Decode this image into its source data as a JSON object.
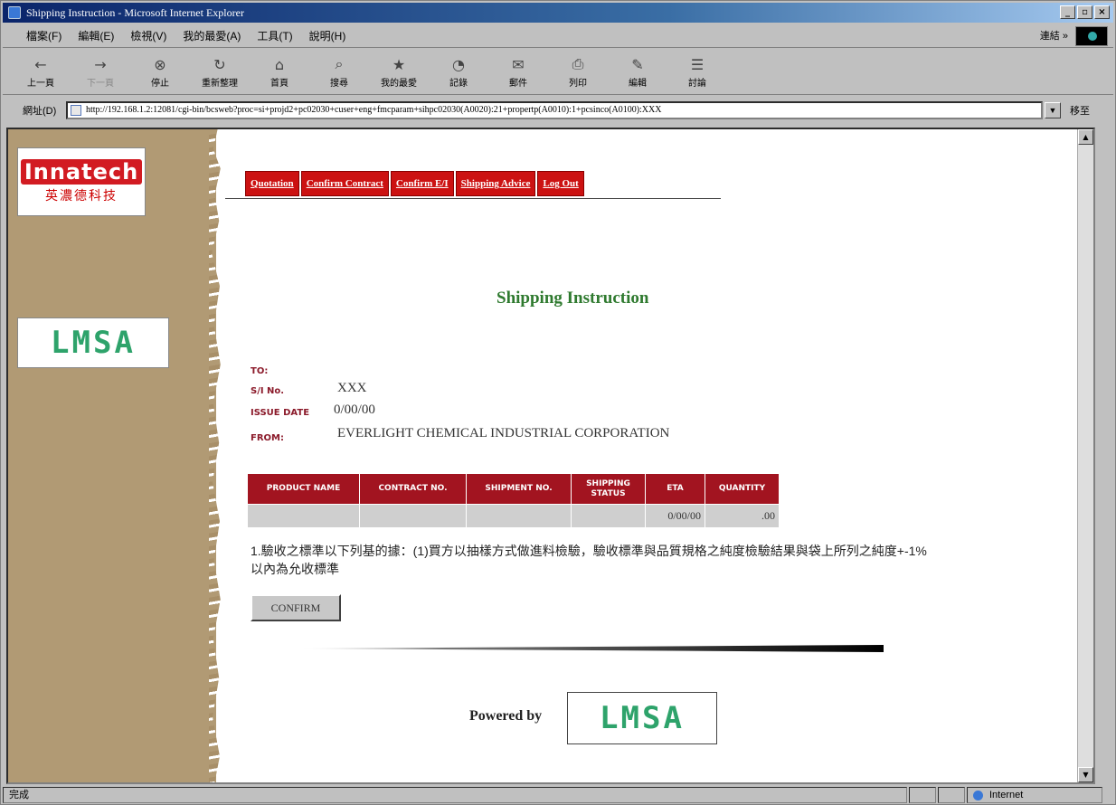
{
  "window": {
    "title": "Shipping Instruction - Microsoft Internet Explorer",
    "buttons": [
      "_",
      "▫",
      "×"
    ]
  },
  "menubar": {
    "items": [
      "檔案(F)",
      "編輯(E)",
      "檢視(V)",
      "我的最愛(A)",
      "工具(T)",
      "說明(H)"
    ],
    "links_label": "連結 »"
  },
  "toolbar": {
    "items": [
      {
        "label": "上一頁",
        "icon": "back-arrow-icon"
      },
      {
        "label": "下一頁",
        "icon": "forward-arrow-icon"
      },
      {
        "label": "停止",
        "icon": "stop-icon"
      },
      {
        "label": "重新整理",
        "icon": "refresh-icon"
      },
      {
        "label": "首頁",
        "icon": "home-icon"
      },
      {
        "label": "搜尋",
        "icon": "search-icon"
      },
      {
        "label": "我的最愛",
        "icon": "favorites-icon"
      },
      {
        "label": "記錄",
        "icon": "history-icon"
      },
      {
        "label": "郵件",
        "icon": "mail-icon"
      },
      {
        "label": "列印",
        "icon": "print-icon"
      },
      {
        "label": "編輯",
        "icon": "edit-icon"
      },
      {
        "label": "討論",
        "icon": "discuss-icon"
      }
    ]
  },
  "addressbar": {
    "label": "網址(D)",
    "url": "http://192.168.1.2:12081/cgi-bin/bcsweb?proc=si+projd2+pc02030+cuser+eng+fmcparam+sihpc02030(A0020):21+propertp(A0010):1+pcsinco(A0100):XXX",
    "go_label": "移至"
  },
  "sidebar": {
    "logo_en": "Innatech",
    "logo_zh": "英濃德科技",
    "logo_lmsa": "LMSA"
  },
  "tabs": [
    "Quotation",
    "Confirm Contract",
    "Confirm E/I",
    "Shipping Advice",
    "Log Out"
  ],
  "page": {
    "title": "Shipping Instruction",
    "fields": {
      "to_label": "TO:",
      "si_label": "S/I No.",
      "si_value": "XXX",
      "issue_label": "ISSUE DATE",
      "issue_value": "0/00/00",
      "from_label": "FROM:",
      "from_value": "EVERLIGHT CHEMICAL INDUSTRIAL CORPORATION"
    },
    "table": {
      "headers": [
        "PRODUCT NAME",
        "CONTRACT NO.",
        "SHIPMENT NO.",
        "SHIPPING STATUS",
        "ETA",
        "QUANTITY"
      ],
      "rows": [
        [
          "",
          "",
          "",
          "",
          "0/00/00",
          ".00"
        ]
      ]
    },
    "note": "1.驗收之標準以下列基的據：(1)買方以抽樣方式做進料檢驗，驗收標準與品質規格之純度檢驗結果與袋上所列之純度+-1%以內為允收標準",
    "confirm_label": "CONFIRM",
    "powered_by": "Powered by",
    "footer_logo": "LMSA"
  },
  "statusbar": {
    "left": "完成",
    "zone": "Internet"
  }
}
